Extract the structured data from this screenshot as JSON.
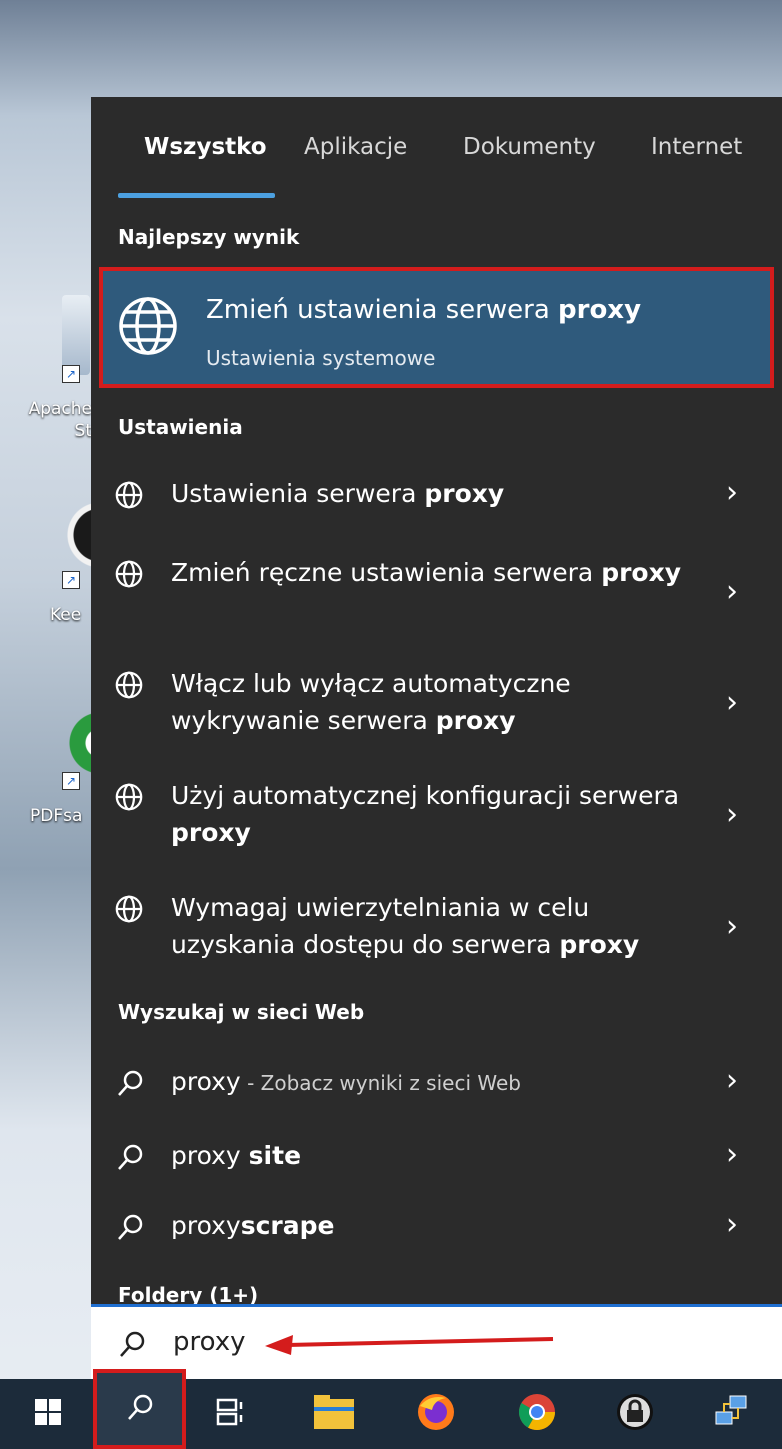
{
  "desktop": {
    "icons": [
      {
        "label": "Apache\nSt",
        "icon": "apache-studio-icon"
      },
      {
        "label": "Kee",
        "icon": "keepass-icon"
      },
      {
        "label": "PDFsa",
        "icon": "pdfsam-icon"
      }
    ]
  },
  "tabs": [
    {
      "label": "Wszystko",
      "active": true
    },
    {
      "label": "Aplikacje",
      "active": false
    },
    {
      "label": "Dokumenty",
      "active": false
    },
    {
      "label": "Internet",
      "active": false
    }
  ],
  "sections": {
    "best": "Najlepszy wynik",
    "settings": "Ustawienia",
    "web": "Wyszukaj w sieci Web",
    "folders": "Foldery (1+)"
  },
  "best_result": {
    "title_prefix": "Zmień ustawienia serwera ",
    "title_bold": "proxy",
    "subtitle": "Ustawienia systemowe",
    "icon": "globe-icon"
  },
  "settings_items": [
    {
      "pre": "Ustawienia serwera ",
      "bold": "proxy",
      "icon": "globe-icon"
    },
    {
      "pre": "Zmień ręczne ustawienia serwera ",
      "bold": "proxy",
      "icon": "globe-icon"
    },
    {
      "pre": "Włącz lub wyłącz automatyczne wykrywanie serwera ",
      "bold": "proxy",
      "icon": "globe-icon"
    },
    {
      "pre": "Użyj automatycznej konfiguracji serwera ",
      "bold": "proxy",
      "icon": "globe-icon"
    },
    {
      "pre": "Wymagaj uwierzytelniania w celu uzyskania dostępu do serwera ",
      "bold": "proxy",
      "icon": "globe-icon"
    }
  ],
  "web_items": [
    {
      "pre": "proxy",
      "muted": " - Zobacz wyniki z sieci Web",
      "bold": "",
      "icon": "search-icon"
    },
    {
      "pre": "proxy ",
      "muted": "",
      "bold": "site",
      "icon": "search-icon"
    },
    {
      "pre": "proxy",
      "muted": "",
      "bold": "scrape",
      "icon": "search-icon"
    }
  ],
  "search": {
    "value": "proxy",
    "placeholder": ""
  },
  "taskbar": [
    "windows-start-icon",
    "search-icon",
    "task-view-icon",
    "file-explorer-icon",
    "firefox-icon",
    "chrome-icon",
    "keepass-icon",
    "network-icon"
  ],
  "colors": {
    "accent": "#4ca0e0",
    "highlight_border": "#d41c1c",
    "best_bg": "#2f5a7c",
    "panel_bg": "#2b2b2b"
  }
}
